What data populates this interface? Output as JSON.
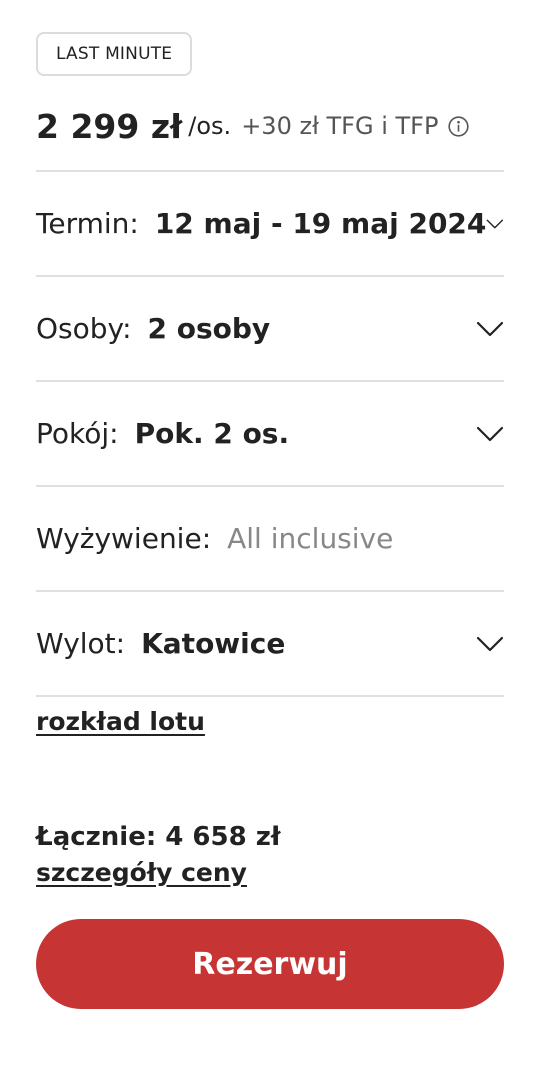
{
  "badge": "LAST MINUTE",
  "price": {
    "main": "2 299 zł",
    "per": "/os.",
    "extra": "+30 zł TFG i TFP"
  },
  "fields": [
    {
      "label": "Termin:",
      "value": "12 maj - 19 maj 2024",
      "has_dropdown": true
    },
    {
      "label": "Osoby:",
      "value": "2 osoby",
      "has_dropdown": true
    },
    {
      "label": "Pokój:",
      "value": "Pok. 2 os.",
      "has_dropdown": true
    },
    {
      "label": "Wyżywienie:",
      "value": "All inclusive",
      "has_dropdown": false
    },
    {
      "label": "Wylot:",
      "value": "Katowice",
      "has_dropdown": true
    }
  ],
  "flight_schedule_link": "rozkład lotu",
  "total": "Łącznie: 4 658 zł",
  "price_details_link": "szczegóły ceny",
  "book_button": "Rezerwuj",
  "colors": {
    "accent": "#c73434",
    "divider": "#e0e0e0",
    "muted_text": "#888888"
  }
}
